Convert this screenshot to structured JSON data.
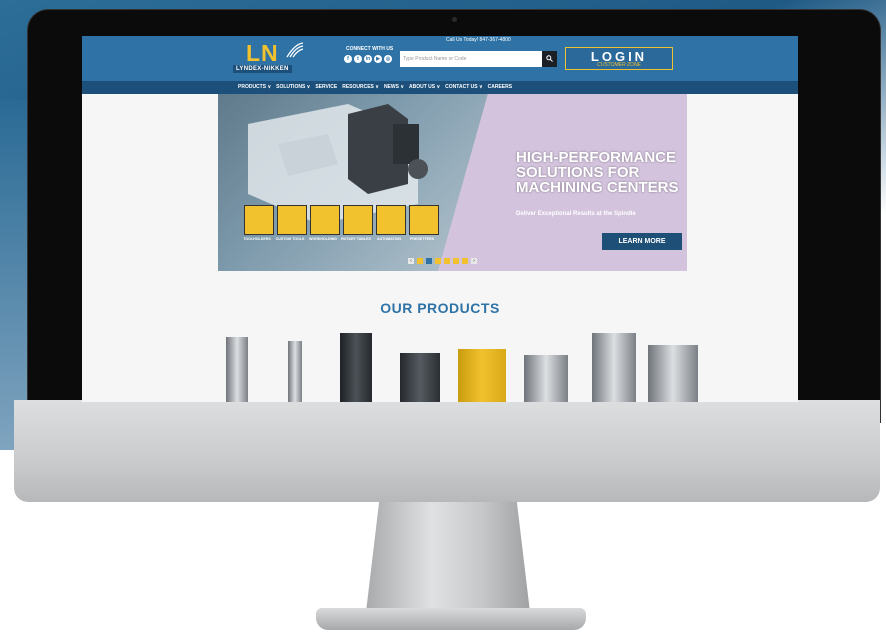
{
  "colors": {
    "brand_blue": "#2f73a6",
    "nav_dark": "#1c4f79",
    "brand_gold": "#f2c12e"
  },
  "header": {
    "logo_letters": "LN",
    "logo_text": "LYNDEX-NIKKEN",
    "connect_label": "CONNECT WITH US",
    "social_icons": [
      "facebook-icon",
      "twitter-icon",
      "linkedin-icon",
      "youtube-icon",
      "instagram-icon"
    ],
    "call_text": "Call Us Today! 847-367-4800",
    "search_placeholder": "Type Product Name or Code",
    "login_label": "LOGIN",
    "login_sub": "CUSTOMER ZONE"
  },
  "nav": {
    "items": [
      "PRODUCTS ∨",
      "SOLUTIONS ∨",
      "SERVICE",
      "RESOURCES ∨",
      "NEWS ∨",
      "ABOUT US ∨",
      "CONTACT US ∨",
      "CAREERS"
    ]
  },
  "hero": {
    "headline": "HIGH-PERFORMANCE SOLUTIONS FOR MACHINING CENTERS",
    "subheadline": "Deliver Exceptional Results at the Spindle",
    "cta": "LEARN MORE",
    "tiles": [
      "TOOLHOLDERS",
      "CUSTOM TOOLS",
      "WORKHOLDING",
      "ROTARY TABLES",
      "AUTOMATION",
      "PRESETTERS"
    ]
  },
  "products": {
    "title": "OUR PRODUCTS"
  }
}
